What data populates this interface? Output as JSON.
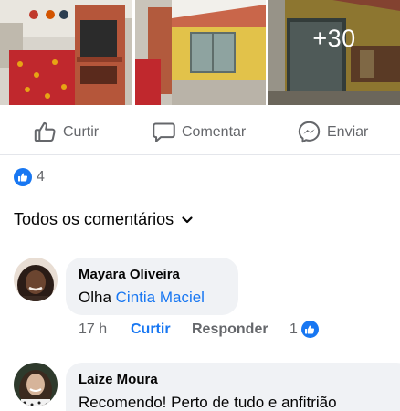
{
  "gallery": {
    "more_count_label": "+30"
  },
  "actions": {
    "like_label": "Curtir",
    "comment_label": "Comentar",
    "send_label": "Enviar"
  },
  "reactions": {
    "count": "4"
  },
  "comments_filter": {
    "label": "Todos os comentários"
  },
  "comments": [
    {
      "author": "Mayara Oliveira",
      "text_prefix": "Olha ",
      "mention": "Cintia Maciel",
      "time": "17 h",
      "like_label": "Curtir",
      "reply_label": "Responder",
      "like_count": "1"
    },
    {
      "author": "Laíze Moura",
      "text": "Recomendo! Perto de tudo e anfitrião"
    }
  ],
  "colors": {
    "accent": "#1877f2",
    "secondary_text": "#65676b",
    "bubble": "#f0f2f5"
  }
}
